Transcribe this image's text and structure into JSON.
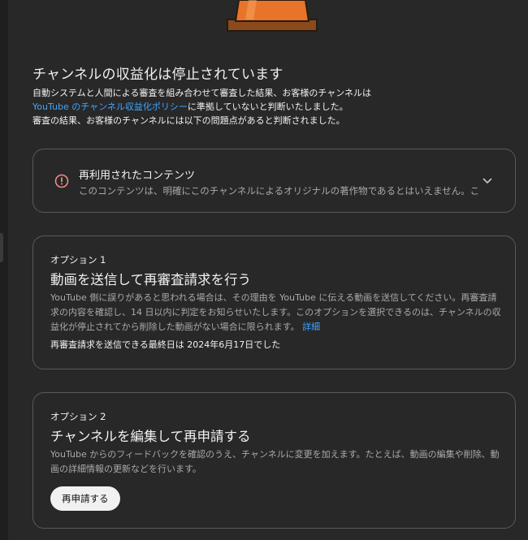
{
  "header": {
    "title": "チャンネルの収益化は停止されています",
    "desc_line1": "自動システムと人間による審査を組み合わせて審査した結果、お客様のチャンネルは",
    "desc_link": "YouTube のチャンネル収益化ポリシー",
    "desc_line2_rest": "に準拠していないと判断いたしました。",
    "desc_line3": "審査の結果、お客様のチャンネルには以下の問題点があると判断されました。"
  },
  "issue": {
    "title": "再利用されたコンテンツ",
    "summary": "このコンテンツは、明確にこのチャンネルによるオリジナルの著作物であるとはいえません。このコ",
    "icon": "error-circle-icon",
    "expand_icon": "chevron-down-icon"
  },
  "option1": {
    "label": "オプション 1",
    "title": "動画を送信して再審査請求を行う",
    "body": "YouTube 側に誤りがあると思われる場合は、その理由を YouTube に伝える動画を送信してください。再審査請求の内容を確認し、14 日以内に判定をお知らせいたします。このオプションを選択できるのは、チャンネルの収益化が停止されてから削除した動画がない場合に限られます。",
    "link": "詳細",
    "deadline": "再審査請求を送信できる最終日は 2024年6月17日でした"
  },
  "option2": {
    "label": "オプション 2",
    "title": "チャンネルを編集して再申請する",
    "body": "YouTube からのフィードバックを確認のうえ、チャンネルに変更を加えます。たとえば、動画の編集や削除、動画の詳細情報の更新などを行います。",
    "button": "再申請する"
  },
  "colors": {
    "background": "#282828",
    "link": "#3ea6ff",
    "error": "#f28b82",
    "cone": "#e8742a"
  }
}
